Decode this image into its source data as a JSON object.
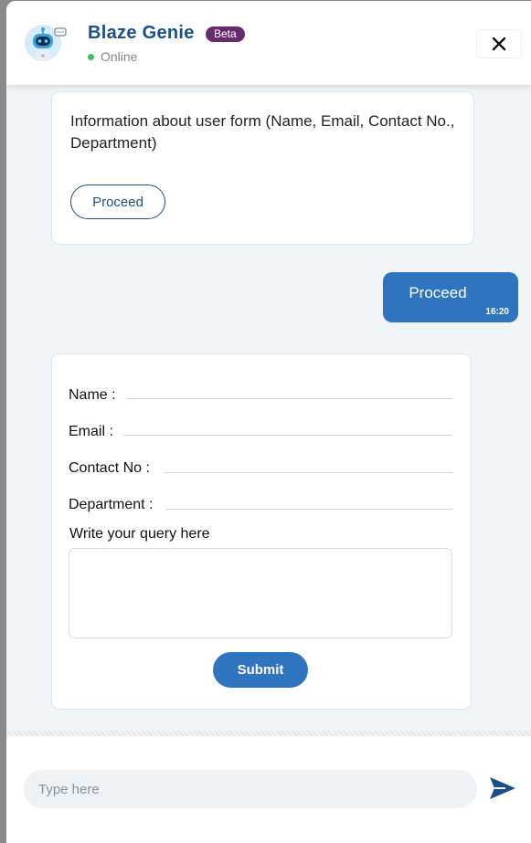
{
  "header": {
    "title": "Blaze Genie",
    "badge": "Beta",
    "status": "Online",
    "close_icon": "close-icon",
    "avatar_icon": "robot-avatar-icon"
  },
  "messages": {
    "bot_1": {
      "text": "Information about user form (Name, Email, Contact No., Department)",
      "option": "Proceed"
    },
    "user_1": {
      "text": "Proceed",
      "time": "16:20"
    },
    "form": {
      "name_label": "Name :",
      "email_label": "Email :",
      "contact_label": "Contact No :",
      "department_label": "Department :",
      "query_label": "Write your query here",
      "submit_label": "Submit"
    }
  },
  "footer": {
    "input_placeholder": "Type here",
    "send_icon": "send-icon"
  },
  "colors": {
    "brand": "#1a4f8b",
    "accent": "#2f74bf",
    "badge": "#6a2b6e",
    "online": "#3cbf5c"
  }
}
